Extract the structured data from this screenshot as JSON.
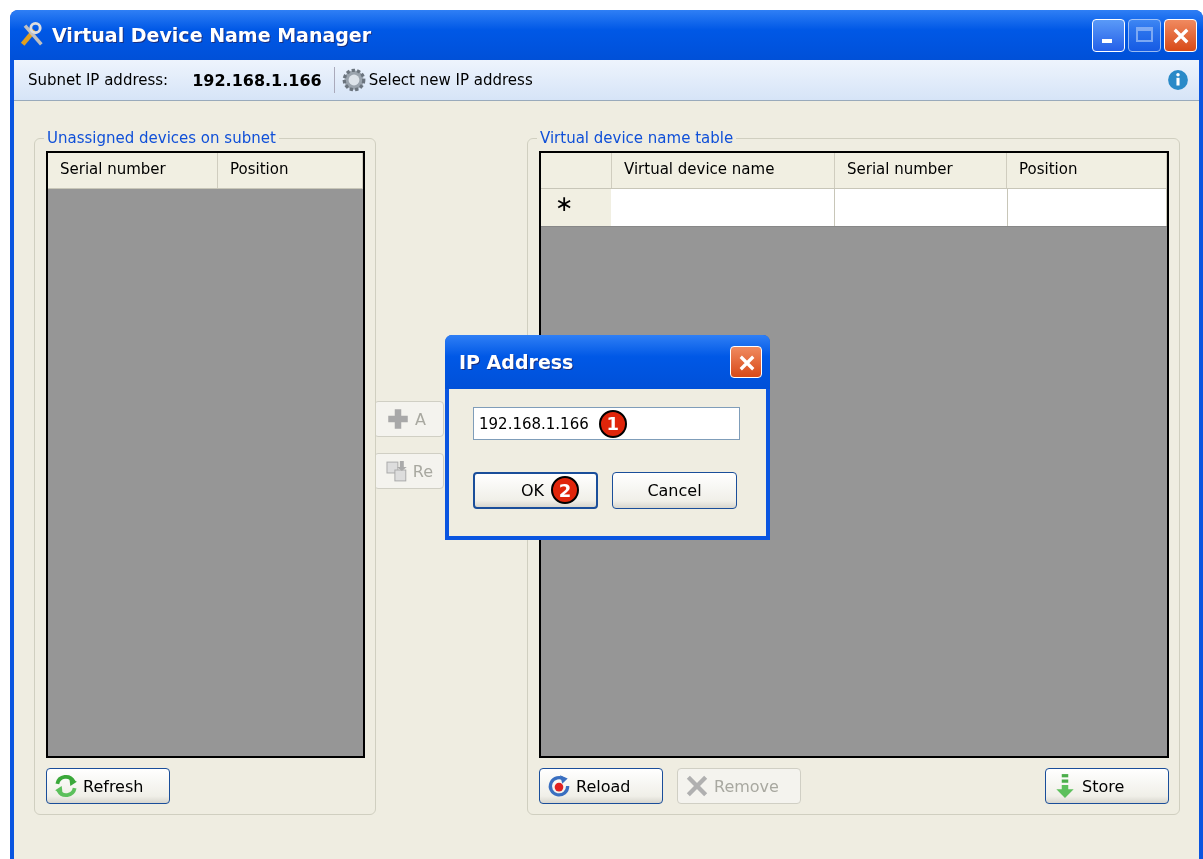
{
  "window": {
    "title": "Virtual Device Name Manager"
  },
  "toolbar": {
    "subnet_label": "Subnet IP address:",
    "subnet_value": "192.168.1.166",
    "select_button": "Select new IP address"
  },
  "unassigned": {
    "title": "Unassigned devices on subnet",
    "columns": [
      "Serial number",
      "Position"
    ],
    "button": "Refresh"
  },
  "middle_buttons": [
    {
      "label": "A",
      "disabled": true,
      "kind": "add"
    },
    {
      "label": "Re",
      "disabled": true,
      "kind": "rename"
    }
  ],
  "virtual_table": {
    "title": "Virtual device name table",
    "columns": [
      "Virtual device name",
      "Serial number",
      "Position"
    ],
    "new_row_marker": "∗",
    "buttons": [
      {
        "label": "Reload",
        "kind": "reload",
        "disabled": false
      },
      {
        "label": "Remove",
        "kind": "remove",
        "disabled": true
      },
      {
        "label": "Store",
        "kind": "store",
        "disabled": false
      }
    ]
  },
  "dialog": {
    "title": "IP Address",
    "value": "192.168.1.166",
    "value_badge": "1",
    "ok": "OK",
    "ok_badge": "2",
    "cancel": "Cancel"
  }
}
